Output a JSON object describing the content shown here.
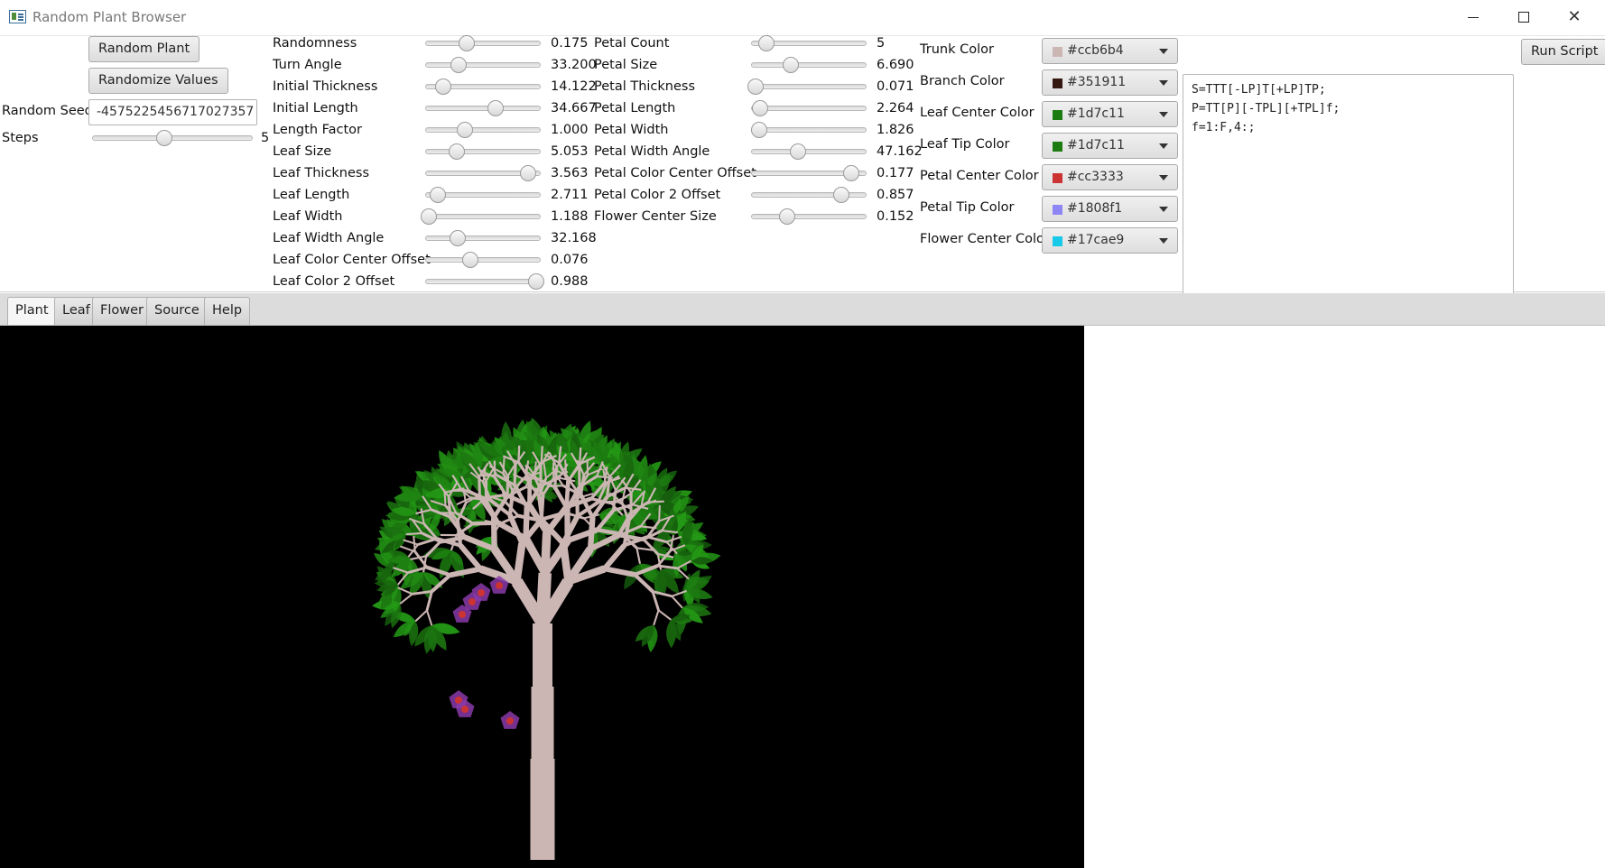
{
  "window": {
    "title": "Random Plant Browser"
  },
  "left_panel": {
    "random_plant_label": "Random Plant",
    "randomize_values_label": "Randomize Values",
    "random_seed_label": "Random Seed",
    "random_seed_value": "-4575225456717027357",
    "steps_label": "Steps",
    "steps_value": "5",
    "steps_level": 0.45
  },
  "params_col1": [
    {
      "label": "Randomness",
      "value": "0.175",
      "level": 0.36
    },
    {
      "label": "Turn Angle",
      "value": "33.200",
      "level": 0.29
    },
    {
      "label": "Initial Thickness",
      "value": "14.122",
      "level": 0.16
    },
    {
      "label": "Initial Length",
      "value": "34.667",
      "level": 0.61
    },
    {
      "label": "Length Factor",
      "value": "1.000",
      "level": 0.34
    },
    {
      "label": "Leaf Size",
      "value": "5.053",
      "level": 0.27
    },
    {
      "label": "Leaf Thickness",
      "value": "3.563",
      "level": 0.89
    },
    {
      "label": "Leaf Length",
      "value": "2.711",
      "level": 0.11
    },
    {
      "label": "Leaf Width",
      "value": "1.188",
      "level": 0.03
    },
    {
      "label": "Leaf Width Angle",
      "value": "32.168",
      "level": 0.28
    },
    {
      "label": "Leaf Color Center Offset",
      "value": "0.076",
      "level": 0.39
    },
    {
      "label": "Leaf Color 2 Offset",
      "value": "0.988",
      "level": 0.96
    }
  ],
  "params_col2": [
    {
      "label": "Petal Count",
      "value": "5",
      "level": 0.13
    },
    {
      "label": "Petal Size",
      "value": "6.690",
      "level": 0.34
    },
    {
      "label": "Petal Thickness",
      "value": "0.071",
      "level": 0.04
    },
    {
      "label": "Petal Length",
      "value": "2.264",
      "level": 0.08
    },
    {
      "label": "Petal Width",
      "value": "1.826",
      "level": 0.07
    },
    {
      "label": "Petal Width Angle",
      "value": "47.162",
      "level": 0.41
    },
    {
      "label": "Petal Color Center Offset",
      "value": "0.177",
      "level": 0.87
    },
    {
      "label": "Petal Color 2 Offset",
      "value": "0.857",
      "level": 0.78
    },
    {
      "label": "Flower Center Size",
      "value": "0.152",
      "level": 0.31
    }
  ],
  "colors": [
    {
      "label": "Trunk Color",
      "value": "#ccb6b4",
      "swatch": "#ccb6b4"
    },
    {
      "label": "Branch Color",
      "value": "#351911",
      "swatch": "#351911"
    },
    {
      "label": "Leaf Center Color",
      "value": "#1d7c11",
      "swatch": "#1d7c11"
    },
    {
      "label": "Leaf Tip Color",
      "value": "#1d7c11",
      "swatch": "#1d7c11"
    },
    {
      "label": "Petal Center Color",
      "value": "#cc3333",
      "swatch": "#cc3333"
    },
    {
      "label": "Petal Tip Color",
      "value": "#1808f1",
      "swatch": "#8f86f5"
    },
    {
      "label": "Flower Center Color",
      "value": "#17cae9",
      "swatch": "#17cae9"
    }
  ],
  "script": {
    "lines": [
      "S=TTT[-LP]T[+LP]TP;",
      "P=TT[P][-TPL][+TPL]f;",
      "f=1:F,4:;"
    ],
    "run_label": "Run Script"
  },
  "tabs": [
    {
      "label": "Plant",
      "active": true
    },
    {
      "label": "Leaf",
      "active": false
    },
    {
      "label": "Flower",
      "active": false
    },
    {
      "label": "Source",
      "active": false
    },
    {
      "label": "Help",
      "active": false
    }
  ]
}
